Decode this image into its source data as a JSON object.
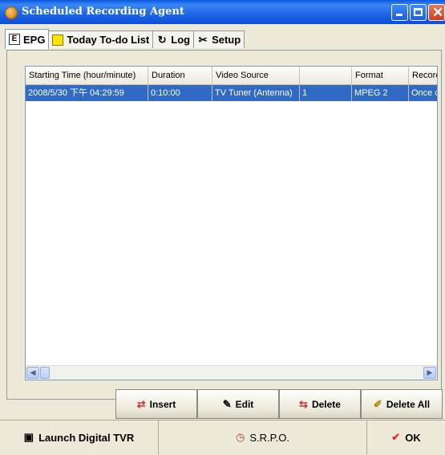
{
  "window": {
    "title": "Scheduled Recording Agent"
  },
  "tabs": [
    {
      "label": "EPG",
      "icon": "epg-icon"
    },
    {
      "label": "Today To-do List",
      "icon": "note-icon"
    },
    {
      "label": "Log",
      "icon": "log-icon"
    },
    {
      "label": "Setup",
      "icon": "tools-icon"
    }
  ],
  "table": {
    "columns": [
      "Starting Time (hour/minute)",
      "Duration",
      "Video Source",
      "",
      "Format",
      "Record"
    ],
    "rows": [
      {
        "start": "2008/5/30 下午 04:29:59",
        "duration": "0:10:00",
        "source": "TV Tuner (Antenna)",
        "channel": "1",
        "format": "MPEG 2",
        "record": "Once daily"
      }
    ]
  },
  "actions": {
    "insert": "Insert",
    "edit": "Edit",
    "delete": "Delete",
    "delete_all": "Delete All"
  },
  "bottom": {
    "launch": "Launch Digital TVR",
    "srpo": "S.R.P.O.",
    "ok": "OK"
  }
}
